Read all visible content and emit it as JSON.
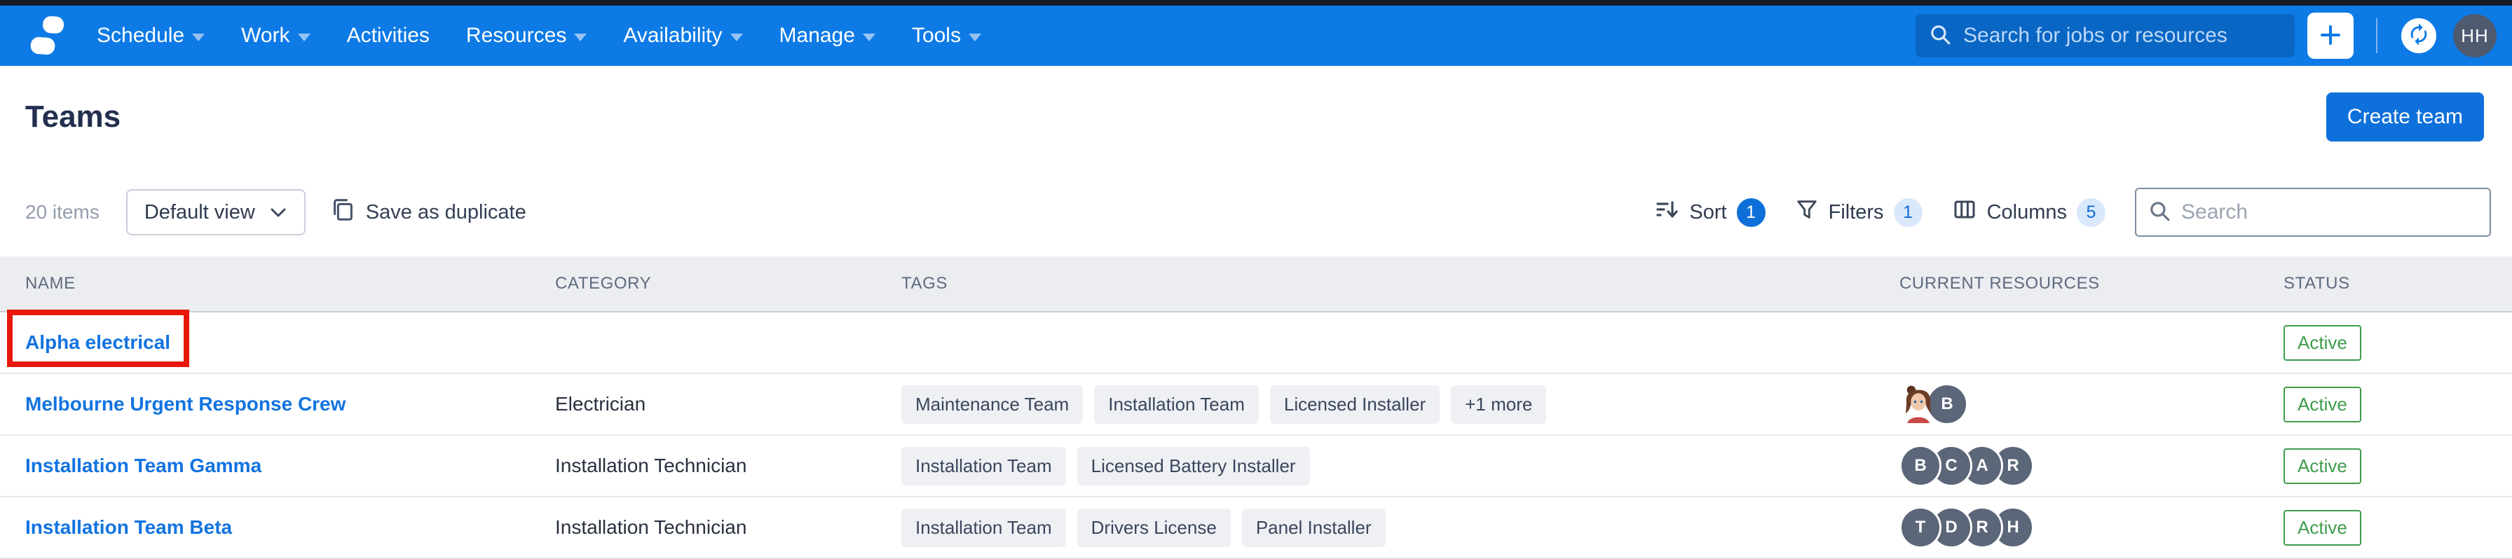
{
  "colors": {
    "nav_blue": "#0d7ae5",
    "nav_search_blue": "#0a66c4",
    "link_blue": "#1273e0",
    "sort_badge_blue": "#0e6fd9",
    "light_badge_bg": "#d9e9fb",
    "status_green": "#3f9c4b",
    "annotation_red": "#e8190c",
    "avatar_slate": "#5b6679"
  },
  "nav": {
    "items": [
      {
        "label": "Schedule",
        "caret": true
      },
      {
        "label": "Work",
        "caret": true
      },
      {
        "label": "Activities",
        "caret": false
      },
      {
        "label": "Resources",
        "caret": true
      },
      {
        "label": "Availability",
        "caret": true
      },
      {
        "label": "Manage",
        "caret": true
      },
      {
        "label": "Tools",
        "caret": true
      }
    ],
    "search_placeholder": "Search for jobs or resources",
    "avatar_initials": "HH"
  },
  "header": {
    "title": "Teams",
    "create_button_label": "Create team"
  },
  "toolbar": {
    "items_count": "20 items",
    "view_selector_label": "Default view",
    "save_as_duplicate_label": "Save as duplicate",
    "sort_label": "Sort",
    "sort_badge": "1",
    "filters_label": "Filters",
    "filters_badge": "1",
    "columns_label": "Columns",
    "columns_badge": "5",
    "search_placeholder": "Search"
  },
  "table": {
    "headers": [
      "NAME",
      "CATEGORY",
      "TAGS",
      "CURRENT RESOURCES",
      "STATUS"
    ],
    "rows": [
      {
        "name": "Alpha electrical",
        "category": "",
        "tags": [],
        "overflow_tag": "",
        "resources": [],
        "status": "Active",
        "annotated": true
      },
      {
        "name": "Melbourne Urgent Response Crew",
        "category": "Electrician",
        "tags": [
          "Maintenance Team",
          "Installation Team",
          "Licensed Installer"
        ],
        "overflow_tag": "+1 more",
        "resources": [
          {
            "type": "image",
            "label": "woman-cartoon-avatar"
          },
          {
            "type": "initials",
            "label": "B"
          }
        ],
        "status": "Active",
        "annotated": false
      },
      {
        "name": "Installation Team Gamma",
        "category": "Installation Technician",
        "tags": [
          "Installation Team",
          "Licensed Battery Installer"
        ],
        "overflow_tag": "",
        "resources": [
          {
            "type": "initials",
            "label": "B"
          },
          {
            "type": "initials",
            "label": "C"
          },
          {
            "type": "initials",
            "label": "A"
          },
          {
            "type": "initials",
            "label": "R"
          }
        ],
        "status": "Active",
        "annotated": false
      },
      {
        "name": "Installation Team Beta",
        "category": "Installation Technician",
        "tags": [
          "Installation Team",
          "Drivers License",
          "Panel Installer"
        ],
        "overflow_tag": "",
        "resources": [
          {
            "type": "initials",
            "label": "T"
          },
          {
            "type": "initials",
            "label": "D"
          },
          {
            "type": "initials",
            "label": "R"
          },
          {
            "type": "initials",
            "label": "H"
          }
        ],
        "status": "Active",
        "annotated": false
      }
    ]
  }
}
